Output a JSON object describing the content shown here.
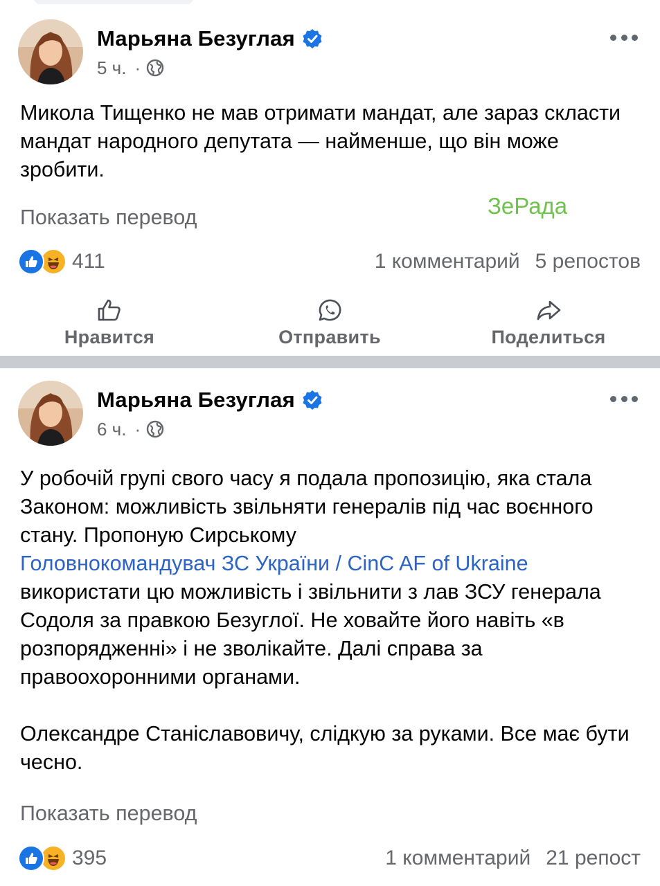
{
  "posts": [
    {
      "author": "Марьяна Безуглая",
      "time": "5 ч.",
      "text": "Микола Тищенко не мав отримати мандат, але зараз скласти мандат народного депутата — найменше, що він може зробити.",
      "translate_label": "Показать перевод",
      "watermark": "ЗеРада",
      "reaction_count": "411",
      "comments": "1 комментарий",
      "shares": "5 репостов",
      "actions": {
        "like": "Нравится",
        "send": "Отправить",
        "share": "Поделиться"
      }
    },
    {
      "author": "Марьяна Безуглая",
      "time": "6 ч.",
      "text_part1": "У робочій групі свого часу я подала пропозицію, яка стала Законом: можливість звільняти генералів під час воєнного стану. Пропоную Сирському",
      "link": "Головнокомандувач ЗС України / CinC AF of Ukraine",
      "text_part2": "використати цю можливість і звільнити з лав ЗСУ генерала Содоля за правкою Безуглої. Не ховайте його навіть «в розпорядженні» і не зволікайте. Далі справа за правоохоронними органами.",
      "text_part3": "Олександре Станіславовичу, слідкую за руками. Все має бути чесно.",
      "translate_label": "Показать перевод",
      "reaction_count": "395",
      "comments": "1 комментарий",
      "shares": "21 репост"
    }
  ],
  "icons": {
    "verified": "verified-badge-icon",
    "privacy": "globe-icon",
    "more": "more-dots-icon",
    "like": "thumbs-up-icon",
    "send": "whatsapp-icon",
    "share": "share-arrow-icon"
  },
  "colors": {
    "verified": "#1b74e4",
    "link": "#2c64c6",
    "watermark": "#6fc24c",
    "secondary_text": "#65676b"
  }
}
